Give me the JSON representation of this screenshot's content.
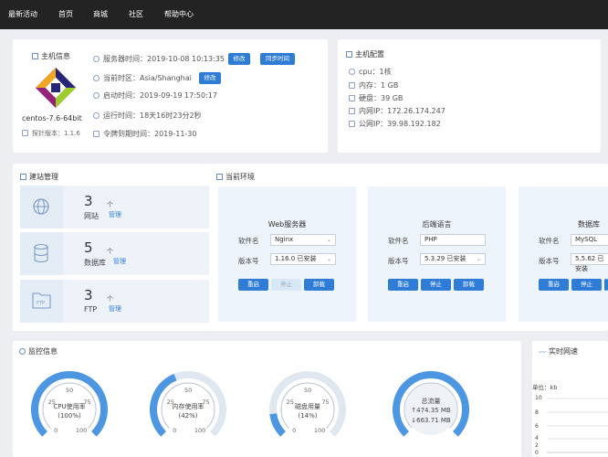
{
  "nav": [
    "最新活动",
    "首页",
    "商城",
    "社区",
    "帮助中心"
  ],
  "host": {
    "title": "主机信息",
    "os": "centos-7.6-64bit",
    "probe": "探针版本：1.1.6",
    "server_time": "服务器时间：2019-10-08 10:13:35",
    "timezone": "当前时区：Asia/Shanghai",
    "boot_time": "启动时间：2019-09-19 17:50:17",
    "uptime": "运行时间：18天16时23分2秒",
    "expire": "令牌到期时间：2019-11-30",
    "btn_modify": "修改",
    "btn_sync": "同步时间",
    "btn_modify2": "修改"
  },
  "config": {
    "title": "主机配置",
    "items": [
      "cpu：1核",
      "内存：1 GB",
      "硬盘：39 GB",
      "内网IP：172.26.174.247",
      "公网IP：39.98.192.182"
    ]
  },
  "site": {
    "title": "建站管理",
    "items": [
      {
        "num": "3",
        "unit": "个",
        "label": "网站",
        "manage": "管理"
      },
      {
        "num": "5",
        "unit": "个",
        "label": "数据库",
        "manage": "管理"
      },
      {
        "num": "3",
        "unit": "个",
        "label": "FTP",
        "manage": "管理"
      }
    ]
  },
  "env": {
    "title": "当前环境",
    "panels": [
      {
        "heading": "Web服务器",
        "f1": "软件名",
        "v1": "Nginx",
        "f2": "版本号",
        "v2": "1.16.0 已安装",
        "b1": "重启",
        "b2": "停止",
        "b3": "卸载"
      },
      {
        "heading": "后端语言",
        "f1": "软件名",
        "v1": "PHP",
        "f2": "版本号",
        "v2": "5.3.29 已安装",
        "b1": "重启",
        "b2": "停止",
        "b3": "卸载"
      },
      {
        "heading": "数据库",
        "f1": "软件名",
        "v1": "MySQL",
        "f2": "版本号",
        "v2": "5.5.62 已安装",
        "b1": "重启",
        "b2": "停止",
        "b3": ""
      }
    ]
  },
  "monitor": {
    "title": "监控信息",
    "gauges": [
      {
        "label": "CPU使用率",
        "value": "(100%)",
        "pct": 100
      },
      {
        "label": "内存使用率",
        "value": "(42%)",
        "pct": 42
      },
      {
        "label": "磁盘用量",
        "value": "(14%)",
        "pct": 14
      }
    ],
    "traffic": {
      "label": "总流量",
      "up": "↑474.35 MB",
      "down": "↓663.71 MB"
    },
    "ticks": {
      "t0": "0",
      "t25": "25",
      "t50": "50",
      "t75": "75",
      "t100": "100"
    }
  },
  "net": {
    "title": "实时网速",
    "unit": "单位：kb",
    "y": [
      "10",
      "8",
      "6",
      "4",
      "2",
      "0"
    ]
  }
}
